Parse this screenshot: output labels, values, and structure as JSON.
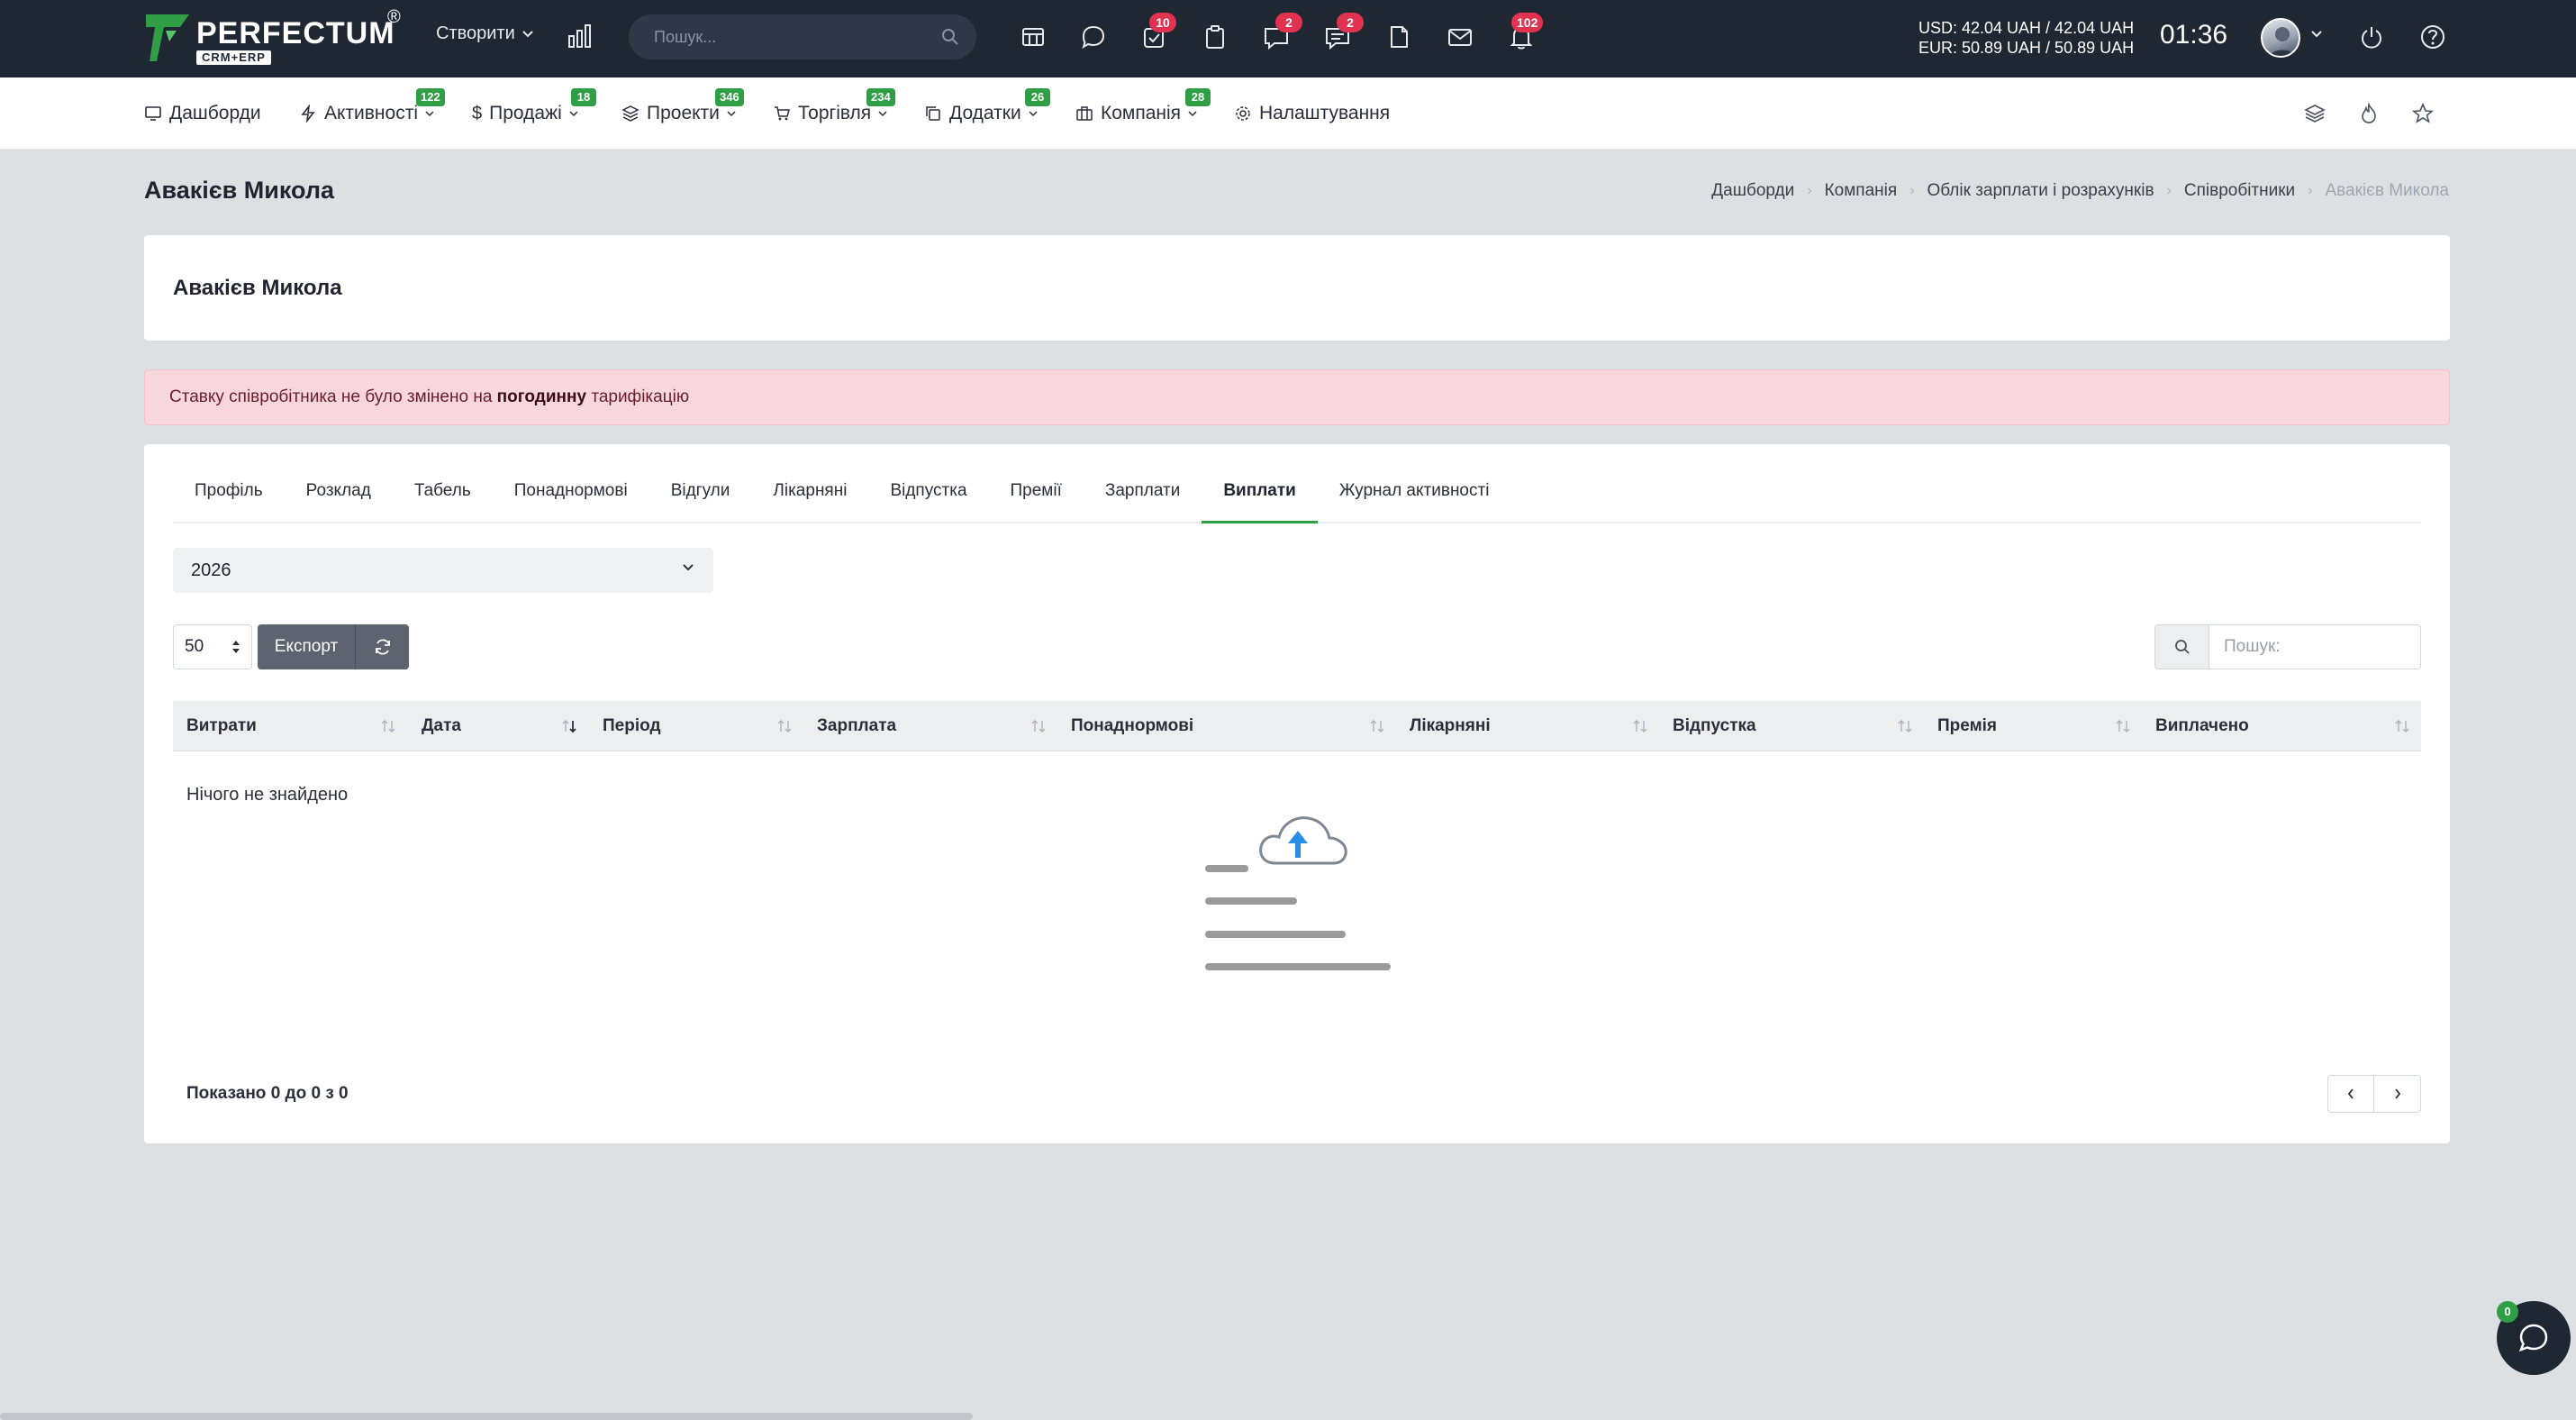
{
  "brand": {
    "name": "PERFECTUM",
    "registered": "®",
    "sub": "CRM+ERP",
    "green": "#2f9e44",
    "dark": "#1f2733"
  },
  "topbar": {
    "create_label": "Створити",
    "search_placeholder": "Пошук...",
    "icons": [
      {
        "name": "calendar-table-icon",
        "badge": ""
      },
      {
        "name": "chat-bubble-icon",
        "badge": ""
      },
      {
        "name": "tasks-check-icon",
        "badge": "10"
      },
      {
        "name": "clipboard-icon",
        "badge": ""
      },
      {
        "name": "messages-icon",
        "badge": "2"
      },
      {
        "name": "comments-icon",
        "badge": "2"
      },
      {
        "name": "document-icon",
        "badge": ""
      },
      {
        "name": "mail-icon",
        "badge": ""
      },
      {
        "name": "bell-icon",
        "badge": "102"
      }
    ],
    "currency_usd": "USD: 42.04 UAH / 42.04 UAH",
    "currency_eur": "EUR: 50.89 UAH / 50.89 UAH",
    "time": "01:36"
  },
  "nav": {
    "items": [
      {
        "label": "Дашборди",
        "badge": ""
      },
      {
        "label": "Активності",
        "badge": "122"
      },
      {
        "label": "Продажі",
        "badge": "18"
      },
      {
        "label": "Проекти",
        "badge": "346"
      },
      {
        "label": "Торгівля",
        "badge": "234"
      },
      {
        "label": "Додатки",
        "badge": "26"
      },
      {
        "label": "Компанія",
        "badge": "28"
      },
      {
        "label": "Налаштування",
        "badge": ""
      }
    ]
  },
  "page": {
    "title": "Авакієв Микола",
    "breadcrumb": [
      "Дашборди",
      "Компанія",
      "Облік зарплати і розрахунків",
      "Співробітники",
      "Авакієв Микола"
    ]
  },
  "employee": {
    "name": "Авакієв Микола"
  },
  "alert": {
    "before": "Ставку співробітника не було змінено на ",
    "bold": "погодинну",
    "after": " тарифікацію",
    "bg_color": "#f8d6dd"
  },
  "tabs": [
    {
      "label": "Профіль"
    },
    {
      "label": "Розклад"
    },
    {
      "label": "Табель"
    },
    {
      "label": "Понаднормові"
    },
    {
      "label": "Відгули"
    },
    {
      "label": "Лікарняні"
    },
    {
      "label": "Відпустка"
    },
    {
      "label": "Премії"
    },
    {
      "label": "Зарплати"
    },
    {
      "label": "Виплати",
      "active": true
    },
    {
      "label": "Журнал активності"
    }
  ],
  "filters": {
    "year": "2026",
    "page_length": "50",
    "export_label": "Експорт",
    "search_placeholder": "Пошук:"
  },
  "table": {
    "columns": [
      "Витрати",
      "Дата",
      "Період",
      "Зарплата",
      "Понаднормові",
      "Лікарняні",
      "Відпустка",
      "Премія",
      "Виплачено"
    ],
    "sorted_column": "Дата",
    "empty_text": "Нічого не знайдено",
    "shown_text": "Показано 0 до 0 з 0"
  },
  "chat": {
    "badge": "0"
  }
}
